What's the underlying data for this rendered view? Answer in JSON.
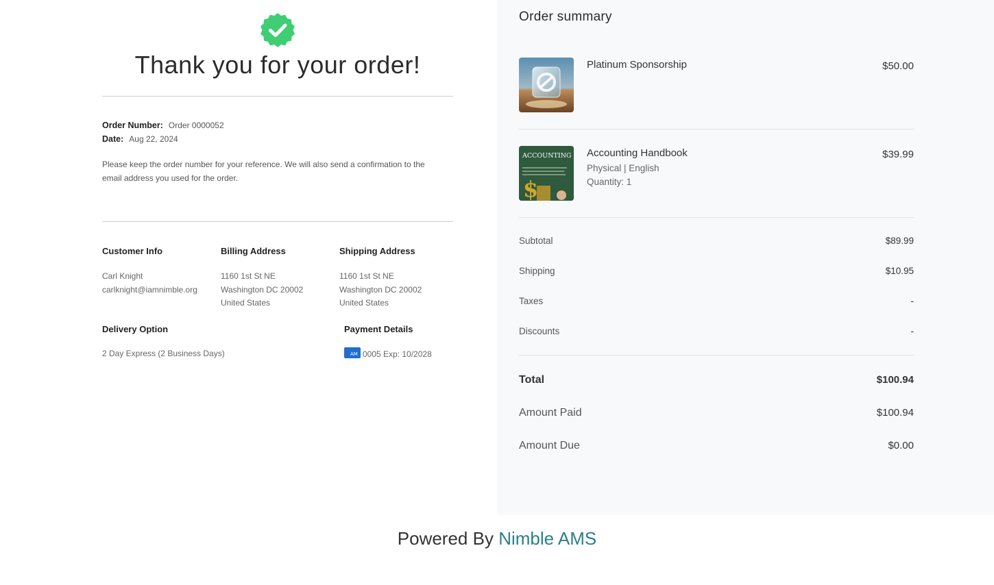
{
  "confirmation": {
    "title": "Thank you for your order!",
    "order_number_label": "Order Number:",
    "order_number_value": "Order 0000052",
    "date_label": "Date:",
    "date_value": "Aug 22, 2024",
    "note": "Please keep the order number for your reference. We will also send a confirmation to the email address you used for the order."
  },
  "customer_info": {
    "heading": "Customer Info",
    "name": "Carl Knight",
    "email": "carlknight@iamnimble.org"
  },
  "billing_address": {
    "heading": "Billing Address",
    "line1": "1160 1st St NE",
    "line2": "Washington DC 20002",
    "line3": "United States"
  },
  "shipping_address": {
    "heading": "Shipping Address",
    "line1": "1160 1st St NE",
    "line2": "Washington DC 20002",
    "line3": "United States"
  },
  "delivery": {
    "heading": "Delivery Option",
    "value": "2 Day Express (2 Business Days)"
  },
  "payment": {
    "heading": "Payment Details",
    "card_icon": "amex-card-icon",
    "value": "0005 Exp: 10/2028"
  },
  "order_summary": {
    "title": "Order summary",
    "items": [
      {
        "name": "Platinum Sponsorship",
        "price": "$50.00"
      },
      {
        "name": "Accounting Handbook",
        "variant": "Physical | English",
        "quantity": "Quantity: 1",
        "price": "$39.99",
        "cover_title": "ACCOUNTING HANDBOOK"
      }
    ],
    "subtotal_label": "Subtotal",
    "subtotal": "$89.99",
    "shipping_label": "Shipping",
    "shipping": "$10.95",
    "taxes_label": "Taxes",
    "taxes": "-",
    "discounts_label": "Discounts",
    "discounts": "-",
    "total_label": "Total",
    "total": "$100.94",
    "paid_label": "Amount Paid",
    "paid": "$100.94",
    "due_label": "Amount Due",
    "due": "$0.00"
  },
  "footer": {
    "prefix": "Powered By",
    "brand": "Nimble AMS"
  },
  "colors": {
    "success_green": "#3fce74",
    "summary_bg": "#f8f9fb",
    "brand_teal": "#2a7f8c",
    "card_blue": "#1f6fce"
  }
}
